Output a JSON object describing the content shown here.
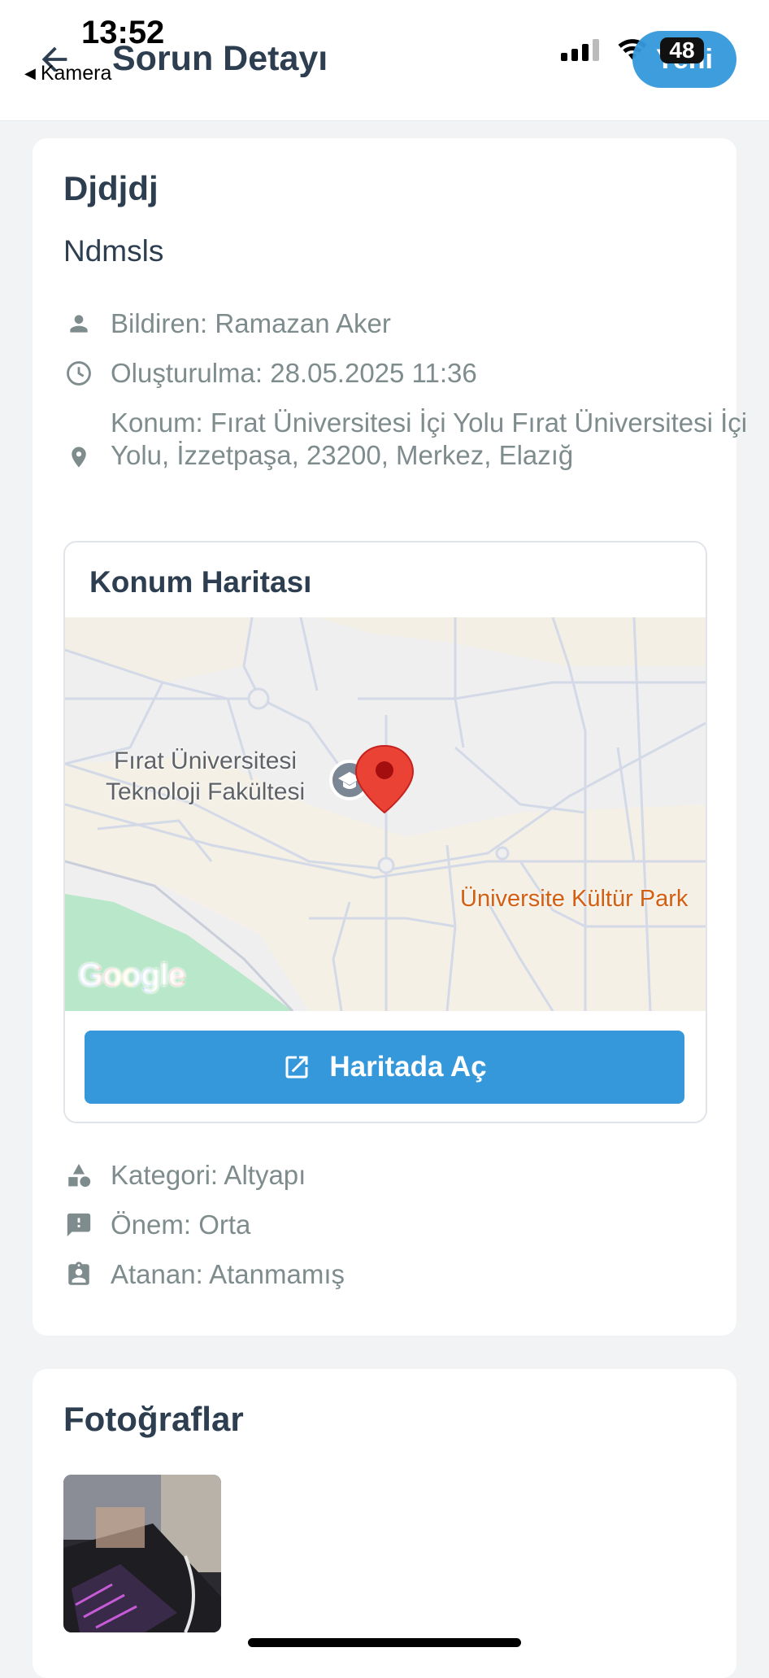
{
  "status_bar": {
    "time": "13:52",
    "back_app": "Kamera",
    "battery": "48"
  },
  "header": {
    "title": "Sorun Detayı",
    "new_button": "Yeni"
  },
  "issue": {
    "title": "Djdjdj",
    "description": "Ndmsls",
    "reporter": "Bildiren: Ramazan Aker",
    "created": "Oluşturulma: 28.05.2025 11:36",
    "location": "Konum: Fırat Üniversitesi İçi Yolu Fırat Üniversitesi İçi Yolu, İzzetpaşa, 23200, Merkez, Elazığ",
    "category": "Kategori: Altyapı",
    "priority": "Önem: Orta",
    "assignee": "Atanan: Atanmamış"
  },
  "map": {
    "title": "Konum Haritası",
    "poi_label_line1": "Fırat Üniversitesi",
    "poi_label_line2": "Teknoloji Fakültesi",
    "park_label": "Üniversite Kültür Park",
    "google_logo": "Google",
    "open_button": "Haritada Aç"
  },
  "photos": {
    "title": "Fotoğraflar"
  },
  "colors": {
    "accent": "#3498db",
    "text_dark": "#2c3e50",
    "text_muted": "#7f8c8d",
    "pin": "#ea4335"
  }
}
